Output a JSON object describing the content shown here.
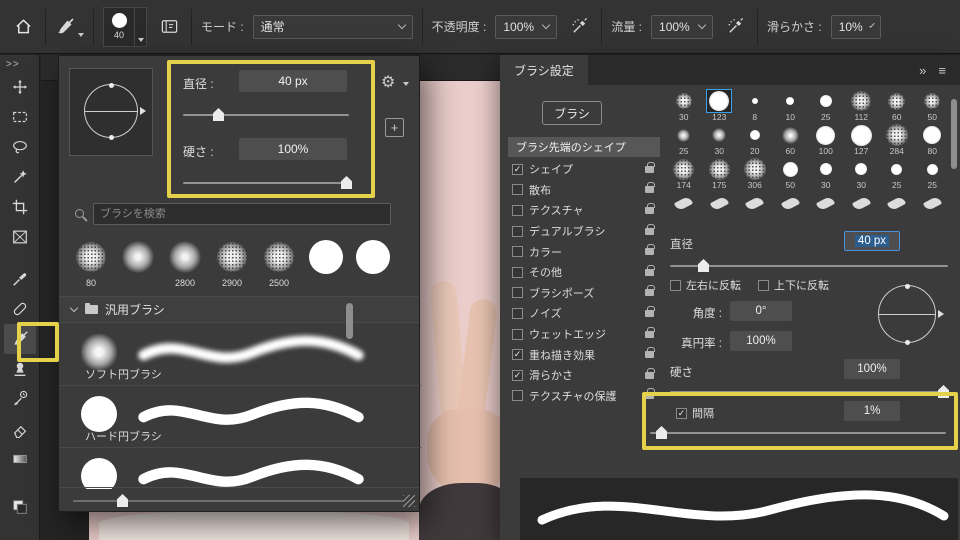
{
  "icons": {
    "gear": "⚙",
    "plus": "+"
  },
  "topbar": {
    "brush_size": "40",
    "mode_label": "モード :",
    "mode_value": "通常",
    "opacity_label": "不透明度 :",
    "opacity_value": "100%",
    "flow_label": "流量 :",
    "flow_value": "100%",
    "smoothing_label": "滑らかさ :",
    "smoothing_value": "10%"
  },
  "toolbar": {
    "expand": ">>",
    "tools": [
      {
        "name": "move-tool"
      },
      {
        "name": "marquee-tool"
      },
      {
        "name": "lasso-tool"
      },
      {
        "name": "object-selection-tool"
      },
      {
        "name": "crop-tool"
      },
      {
        "name": "frame-tool"
      },
      {
        "name": "eyedropper-tool"
      },
      {
        "name": "healing-brush-tool"
      },
      {
        "name": "brush-tool",
        "state": "selected"
      },
      {
        "name": "clone-stamp-tool"
      },
      {
        "name": "history-brush-tool"
      },
      {
        "name": "eraser-tool"
      },
      {
        "name": "gradient-tool"
      }
    ]
  },
  "popup": {
    "diameter_label": "直径 :",
    "diameter_value": "40 px",
    "hardness_label": "硬さ :",
    "hardness_value": "100%",
    "search_placeholder": "ブラシを検索",
    "presets": [
      {
        "num": "80",
        "type": "t-texture",
        "d": 30
      },
      {
        "num": "",
        "type": "t-soft",
        "d": 32
      },
      {
        "num": "2800",
        "type": "t-soft",
        "d": 32
      },
      {
        "num": "2900",
        "type": "t-texture",
        "d": 30
      },
      {
        "num": "2500",
        "type": "t-texture",
        "d": 30
      },
      {
        "num": "",
        "type": "t-hard",
        "d": 34
      },
      {
        "num": "",
        "type": "t-hard",
        "d": 34
      }
    ],
    "folder_label": "汎用ブラシ",
    "brushes": [
      {
        "label": "ソフト円ブラシ",
        "type": "soft"
      },
      {
        "label": "ハード円ブラシ",
        "type": "hard"
      },
      {
        "label": "",
        "type": "hard"
      }
    ]
  },
  "panel": {
    "tab": "ブラシ設定",
    "collapse_icon": "»",
    "menu_icon": "≡",
    "brush_button": "ブラシ",
    "tip_shape_header": "ブラシ先端のシェイプ",
    "options": [
      {
        "check": "✓",
        "label": "シェイプ"
      },
      {
        "check": "",
        "label": "散布"
      },
      {
        "check": "",
        "label": "テクスチャ"
      },
      {
        "check": "",
        "label": "デュアルブラシ"
      },
      {
        "check": "",
        "label": "カラー"
      },
      {
        "check": "",
        "label": "その他"
      },
      {
        "check": "",
        "label": "ブラシポーズ"
      },
      {
        "check": "",
        "label": "ノイズ"
      },
      {
        "check": "",
        "label": "ウェットエッジ"
      },
      {
        "check": "✓",
        "label": "重ね描き効果"
      },
      {
        "check": "✓",
        "label": "滑らかさ"
      },
      {
        "check": "",
        "label": "テクスチャの保護"
      }
    ],
    "grid": [
      {
        "n": "30",
        "type": "t-texture",
        "d": 16
      },
      {
        "n": "123",
        "type": "t-dot",
        "d": 20,
        "state": "selected"
      },
      {
        "n": "8",
        "type": "t-dot",
        "d": 6
      },
      {
        "n": "10",
        "type": "t-dot",
        "d": 8
      },
      {
        "n": "25",
        "type": "t-dot",
        "d": 12
      },
      {
        "n": "112",
        "type": "t-texture",
        "d": 20
      },
      {
        "n": "60",
        "type": "t-texture",
        "d": 17
      },
      {
        "n": "50",
        "type": "t-texture",
        "d": 16
      },
      {
        "n": "25",
        "type": "t-soft",
        "d": 13
      },
      {
        "n": "30",
        "type": "t-soft",
        "d": 14
      },
      {
        "n": "20",
        "type": "t-dot",
        "d": 10
      },
      {
        "n": "60",
        "type": "t-soft",
        "d": 17
      },
      {
        "n": "100",
        "type": "t-dot",
        "d": 19
      },
      {
        "n": "127",
        "type": "t-dot",
        "d": 21
      },
      {
        "n": "284",
        "type": "t-texture",
        "d": 22
      },
      {
        "n": "80",
        "type": "t-dot",
        "d": 18
      },
      {
        "n": "174",
        "type": "t-texture",
        "d": 21
      },
      {
        "n": "175",
        "type": "t-texture",
        "d": 21
      },
      {
        "n": "306",
        "type": "t-texture",
        "d": 22
      },
      {
        "n": "50",
        "type": "t-dot",
        "d": 15
      },
      {
        "n": "30",
        "type": "t-dot",
        "d": 12
      },
      {
        "n": "30",
        "type": "t-dot",
        "d": 12
      },
      {
        "n": "25",
        "type": "t-dot",
        "d": 11
      },
      {
        "n": "25",
        "type": "t-dot",
        "d": 11
      },
      {
        "n": "",
        "type": "t-tip",
        "d": 16
      },
      {
        "n": "",
        "type": "t-tip",
        "d": 16
      },
      {
        "n": "",
        "type": "t-tip",
        "d": 16
      },
      {
        "n": "",
        "type": "t-tip",
        "d": 16
      },
      {
        "n": "",
        "type": "t-tip",
        "d": 16
      },
      {
        "n": "",
        "type": "t-tip",
        "d": 16
      },
      {
        "n": "",
        "type": "t-tip",
        "d": 16
      },
      {
        "n": "",
        "type": "t-tip",
        "d": 16
      }
    ],
    "diameter_label": "直径",
    "diameter_value": "40 px",
    "flip_x": "左右に反転",
    "flip_y": "上下に反転",
    "angle_label": "角度 :",
    "angle_value": "0°",
    "roundness_label": "真円率 :",
    "roundness_value": "100%",
    "hardness_label": "硬さ",
    "hardness_value": "100%",
    "spacing_label": "間隔",
    "spacing_check": "✓",
    "spacing_value": "1%"
  }
}
